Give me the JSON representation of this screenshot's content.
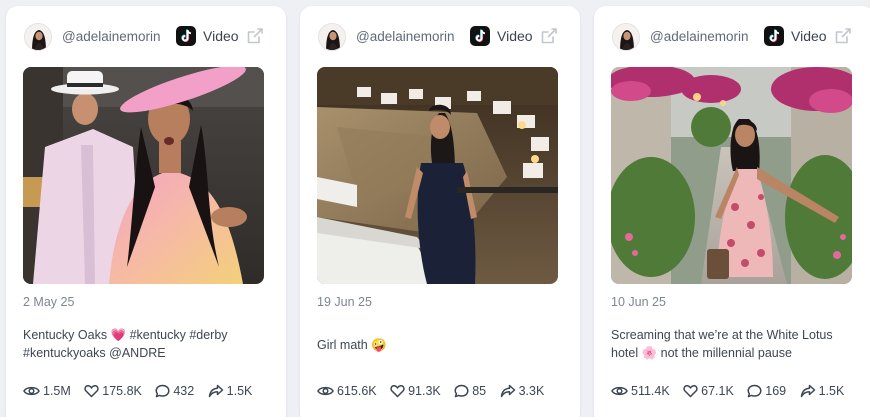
{
  "posts": [
    {
      "handle": "@adelainemorin",
      "platform_icon": "tiktok-icon",
      "type_label": "Video",
      "date": "2 May 25",
      "caption": "Kentucky Oaks 💗 #kentucky #derby #kentuckyoaks @ANDRE",
      "thumbnail": "kentucky-oaks-photo",
      "stats": {
        "views": "1.5M",
        "likes": "175.8K",
        "comments": "432",
        "shares": "1.5K"
      }
    },
    {
      "handle": "@adelainemorin",
      "platform_icon": "tiktok-icon",
      "type_label": "Video",
      "date": "19 Jun 25",
      "caption": "Girl math 🤪",
      "thumbnail": "terrace-restaurant-photo",
      "stats": {
        "views": "615.6K",
        "likes": "91.3K",
        "comments": "85",
        "shares": "3.3K"
      }
    },
    {
      "handle": "@adelainemorin",
      "platform_icon": "tiktok-icon",
      "type_label": "Video",
      "date": "10 Jun 25",
      "caption": "Screaming that we’re at the White Lotus hotel 🌸 not the millennial pause",
      "thumbnail": "white-lotus-garden-photo",
      "stats": {
        "views": "511.4K",
        "likes": "67.1K",
        "comments": "169",
        "shares": "1.5K"
      }
    }
  ],
  "colors": {
    "card_bg": "#ffffff",
    "page_bg": "#eef0f4",
    "text": "#3d4654",
    "muted": "#7d8694"
  }
}
